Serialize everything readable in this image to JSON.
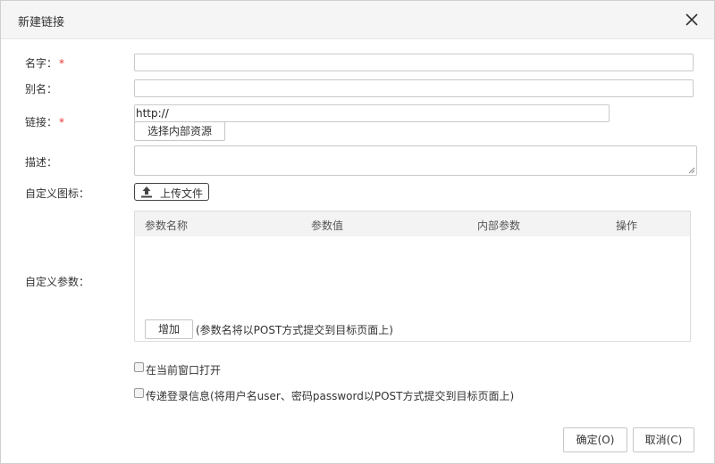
{
  "dialog": {
    "title": "新建链接",
    "close_icon": "close-icon"
  },
  "form": {
    "name": {
      "label": "名字：",
      "required_mark": "*",
      "value": ""
    },
    "alias": {
      "label": "别名：",
      "value": ""
    },
    "link": {
      "label": "链接：",
      "required_mark": "*",
      "value": "http://",
      "select_button": "选择内部资源"
    },
    "description": {
      "label": "描述：",
      "value": ""
    },
    "custom_icon": {
      "label": "自定义图标：",
      "upload_button": "上传文件",
      "icon": "upload-icon"
    },
    "custom_params": {
      "label": "自定义参数：",
      "columns": [
        "参数名称",
        "参数值",
        "内部参数",
        "操作"
      ],
      "rows": [],
      "add_button": "增加",
      "note": "(参数名将以POST方式提交到目标页面上)"
    },
    "options": [
      {
        "label": "在当前窗口打开",
        "checked": false
      },
      {
        "label": "传递登录信息(将用户名user、密码password以POST方式提交到目标页面上)",
        "checked": false
      }
    ]
  },
  "footer": {
    "ok_button": "确定(O)",
    "cancel_button": "取消(C)"
  },
  "colors": {
    "required": "#e33333",
    "header_bg": "#f5f5f5",
    "table_header_bg": "#f3f3f3"
  }
}
